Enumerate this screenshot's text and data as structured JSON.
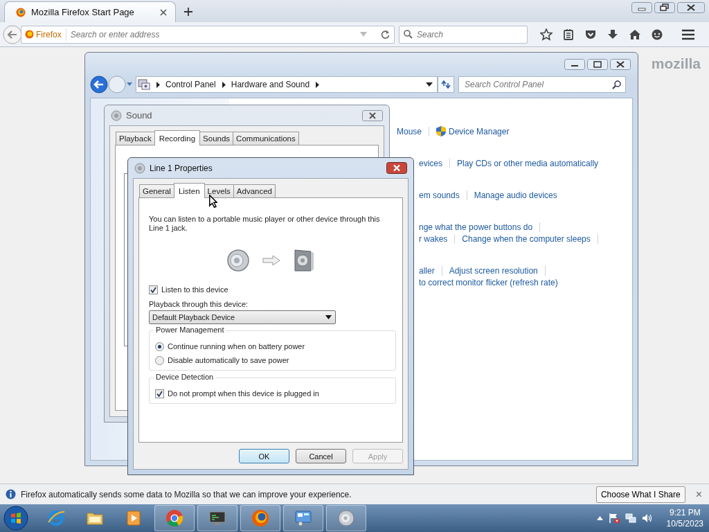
{
  "browser": {
    "tabs": [
      {
        "title": "Mozilla Firefox Start Page",
        "selected": true
      }
    ],
    "identity": "Firefox",
    "address": {
      "placeholder": "Search or enter address"
    },
    "search": {
      "placeholder": "Search"
    }
  },
  "page": {
    "logo": "mozilla"
  },
  "control_panel": {
    "breadcrumb": [
      "Control Panel",
      "Hardware and Sound"
    ],
    "search": {
      "placeholder": "Search Control Panel"
    },
    "link_groups": [
      {
        "rows": [
          {
            "links": [
              {
                "label": "Mouse",
                "kind": "plain"
              },
              {
                "label": "Device Manager",
                "kind": "shield"
              }
            ],
            "more": false
          }
        ]
      },
      {
        "rows": [
          {
            "links": [
              {
                "label": "evices",
                "kind": "plain"
              },
              {
                "label": "Play CDs or other media automatically",
                "kind": "plain"
              }
            ],
            "more": false
          }
        ]
      },
      {
        "rows": [
          {
            "links": [
              {
                "label": "em sounds",
                "kind": "plain"
              },
              {
                "label": "Manage audio devices",
                "kind": "plain"
              }
            ],
            "more": false
          }
        ]
      },
      {
        "rows": [
          {
            "links": [
              {
                "label": "nge what the power buttons do",
                "kind": "plain"
              }
            ],
            "more": true
          },
          {
            "links": [
              {
                "label": "r wakes",
                "kind": "plain"
              },
              {
                "label": "Change when the computer sleeps",
                "kind": "plain"
              }
            ],
            "more": true
          }
        ]
      },
      {
        "rows": [
          {
            "links": [
              {
                "label": "aller",
                "kind": "plain"
              },
              {
                "label": "Adjust screen resolution",
                "kind": "plain"
              }
            ],
            "more": true
          },
          {
            "links": [
              {
                "label": "to correct monitor flicker (refresh rate)",
                "kind": "plain"
              }
            ],
            "more": false
          }
        ]
      }
    ]
  },
  "sound_dialog": {
    "title": "Sound",
    "tabs": [
      {
        "label": "Playback",
        "selected": false
      },
      {
        "label": "Recording",
        "selected": true
      },
      {
        "label": "Sounds",
        "selected": false
      },
      {
        "label": "Communications",
        "selected": false
      }
    ]
  },
  "properties_dialog": {
    "title": "Line 1 Properties",
    "tabs": [
      {
        "label": "General",
        "selected": false
      },
      {
        "label": "Listen",
        "selected": true
      },
      {
        "label": "Levels",
        "selected": false
      },
      {
        "label": "Advanced",
        "selected": false
      }
    ],
    "description": "You can listen to a portable music player or other device through this Line 1 jack.",
    "listen": {
      "label": "Listen to this device",
      "checked": true
    },
    "playback_label": "Playback through this device:",
    "playback_device": {
      "value": "Default Playback Device"
    },
    "power_management": {
      "title": "Power Management",
      "options": [
        {
          "label": "Continue running when on battery power",
          "selected": true
        },
        {
          "label": "Disable automatically to save power",
          "selected": false
        }
      ]
    },
    "device_detection": {
      "title": "Device Detection",
      "option": {
        "label": "Do not prompt when this device is plugged in",
        "checked": true
      }
    },
    "buttons": [
      {
        "label": "OK",
        "kind": "default"
      },
      {
        "label": "Cancel",
        "kind": "normal"
      },
      {
        "label": "Apply",
        "kind": "disabled"
      }
    ]
  },
  "notification": {
    "text": "Firefox automatically sends some data to Mozilla so that we can improve your experience.",
    "button": "Choose What I Share",
    "close": "×"
  },
  "taskbar": {
    "apps": [
      {
        "kind": "ie",
        "running": false
      },
      {
        "kind": "explorer",
        "running": false
      },
      {
        "kind": "media",
        "running": false
      },
      {
        "kind": "chrome",
        "running": true
      },
      {
        "kind": "monitor",
        "running": true
      },
      {
        "kind": "firefox",
        "running": true
      },
      {
        "kind": "panel",
        "running": true
      },
      {
        "kind": "speaker",
        "running": true
      }
    ],
    "time": "9:21 PM",
    "date": "10/5/2023"
  }
}
